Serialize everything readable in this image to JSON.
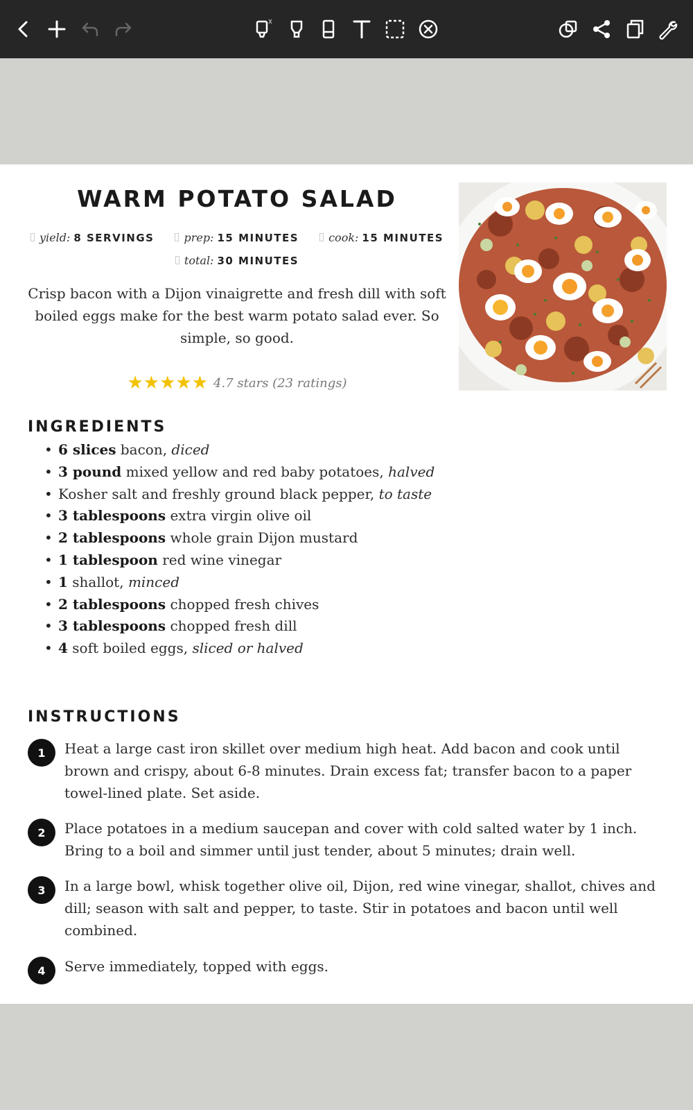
{
  "toolbar": {
    "icons": [
      "back-icon",
      "add-icon",
      "undo-icon",
      "redo-icon",
      "pen-icon",
      "marker-icon",
      "eraser-icon",
      "text-icon",
      "lasso-icon",
      "close-circle-icon",
      "shapes-icon",
      "share-icon",
      "copy-icon",
      "wrench-icon"
    ]
  },
  "recipe": {
    "title": "WARM POTATO SALAD",
    "meta": {
      "yield_label": "yield:",
      "yield_value": "8 SERVINGS",
      "prep_label": "prep:",
      "prep_value": "15 MINUTES",
      "cook_label": "cook:",
      "cook_value": "15 MINUTES",
      "total_label": "total:",
      "total_value": "30 MINUTES"
    },
    "summary": "Crisp bacon with a Dijon vinaigrette and fresh dill with soft boiled eggs make for the best warm potato salad ever. So simple, so good.",
    "rating": {
      "stars": 5,
      "text": "4.7 stars (23 ratings)"
    },
    "ingredients_heading": "INGREDIENTS",
    "ingredients": [
      {
        "qty": "6 slices",
        "item": " bacon, ",
        "note": "diced"
      },
      {
        "qty": "3 pound",
        "item": " mixed yellow and red baby potatoes, ",
        "note": "halved"
      },
      {
        "qty": "",
        "item": "Kosher salt and freshly ground black pepper, ",
        "note": "to taste"
      },
      {
        "qty": "3 tablespoons",
        "item": " extra virgin olive oil",
        "note": ""
      },
      {
        "qty": "2 tablespoons",
        "item": " whole grain Dijon mustard",
        "note": ""
      },
      {
        "qty": "1 tablespoon",
        "item": " red wine vinegar",
        "note": ""
      },
      {
        "qty": "1",
        "item": " shallot, ",
        "note": "minced"
      },
      {
        "qty": "2 tablespoons",
        "item": " chopped fresh chives",
        "note": ""
      },
      {
        "qty": "3 tablespoons",
        "item": " chopped fresh dill",
        "note": ""
      },
      {
        "qty": "4",
        "item": " soft boiled eggs, ",
        "note": "sliced or halved"
      }
    ],
    "instructions_heading": "INSTRUCTIONS",
    "instructions": [
      {
        "num": "1",
        "text": "Heat a large cast iron skillet over medium high heat. Add bacon and cook until brown and crispy, about 6-8 minutes. Drain excess fat; transfer bacon to a paper towel-lined plate. Set aside."
      },
      {
        "num": "2",
        "text": "Place potatoes in a medium saucepan and cover with cold salted water by 1 inch. Bring to a boil and simmer until just tender, about 5 minutes; drain well."
      },
      {
        "num": "3",
        "text": "In a large bowl, whisk together olive oil, Dijon, red wine vinegar, shallot, chives and dill; season with salt and pepper, to taste. Stir in potatoes and bacon until well combined."
      },
      {
        "num": "4",
        "text": "Serve immediately, topped with eggs."
      }
    ]
  },
  "colors": {
    "toolbar_bg": "#262626",
    "canvas_bg": "#d1d2cd",
    "page_bg": "#ffffff",
    "star": "#f2c200"
  }
}
